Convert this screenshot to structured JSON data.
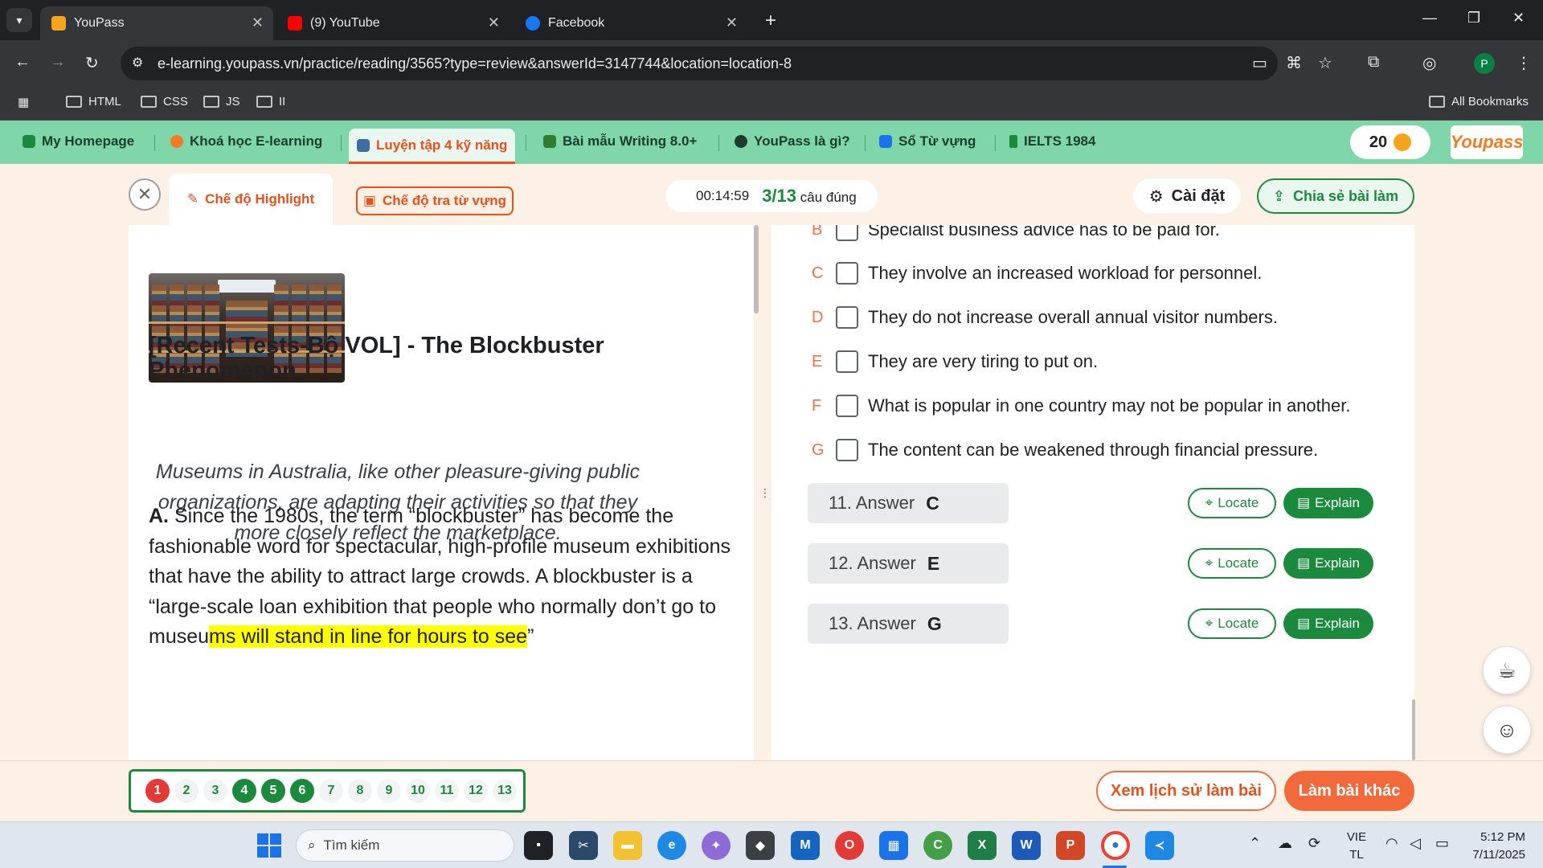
{
  "browser": {
    "tabs": [
      {
        "title": "YouPass",
        "active": true
      },
      {
        "title": "(9) YouTube",
        "active": false
      },
      {
        "title": "Facebook",
        "active": false
      }
    ],
    "url": "e-learning.youpass.vn/practice/reading/3565?type=review&answerId=3147744&location=location-8",
    "bookmarks": [
      "HTML",
      "CSS",
      "JS",
      "II"
    ],
    "all_bookmarks_label": "All Bookmarks",
    "profile_initial": "P"
  },
  "site_nav": {
    "items": [
      "My Homepage",
      "Khoá học E-learning",
      "Luyện tập 4 kỹ năng",
      "Bài mẫu Writing 8.0+",
      "YouPass là gì?",
      "Sổ Từ vựng",
      "IELTS 1984"
    ],
    "active_index": 2,
    "coins": "20",
    "logo_text": "Youpass"
  },
  "mode_bar": {
    "highlight_mode": "Chế độ Highlight",
    "vocab_mode": "Chế độ tra từ vựng",
    "timer": "00:14:59",
    "score": "3/13",
    "score_suffix": "câu đúng",
    "settings": "Cài đặt",
    "share": "Chia sẻ bài làm"
  },
  "article": {
    "title": "[Recent Tests-Bộ VOL] - The Blockbuster Phenomenon",
    "lead": "Museums in Australia, like other pleasure-giving public organizations, are adapting their activities so that they more closely reflect the marketplace.",
    "para_label": "A.",
    "para_text": " Since the 1980s, the term “blockbuster” has become the fashionable word for spectacular, high-profile museum exhibitions that have the ability to attract large crowds. A blockbuster is a “large-scale loan exhibition that people who normally don’t go to museu",
    "para_highlight": "ms will stand in line for hours to see",
    "para_end": "”"
  },
  "options": [
    {
      "letter": "B",
      "text": "Specialist business advice has to be paid for."
    },
    {
      "letter": "C",
      "text": "They involve an increased workload for personnel."
    },
    {
      "letter": "D",
      "text": "They do not increase overall annual visitor numbers."
    },
    {
      "letter": "E",
      "text": "They are very tiring to put on."
    },
    {
      "letter": "F",
      "text": "What is popular in one country may not be popular in another."
    },
    {
      "letter": "G",
      "text": "The content can be weakened through financial pressure."
    }
  ],
  "answers": [
    {
      "label": "11. Answer",
      "value": "C"
    },
    {
      "label": "12. Answer",
      "value": "E"
    },
    {
      "label": "13. Answer",
      "value": "G"
    }
  ],
  "locate_label": "Locate",
  "explain_label": "Explain",
  "question_nav": [
    {
      "n": "1",
      "state": "wrong"
    },
    {
      "n": "2",
      "state": "none"
    },
    {
      "n": "3",
      "state": "none"
    },
    {
      "n": "4",
      "state": "right"
    },
    {
      "n": "5",
      "state": "right"
    },
    {
      "n": "6",
      "state": "right"
    },
    {
      "n": "7",
      "state": "none"
    },
    {
      "n": "8",
      "state": "none"
    },
    {
      "n": "9",
      "state": "none"
    },
    {
      "n": "10",
      "state": "none"
    },
    {
      "n": "11",
      "state": "none"
    },
    {
      "n": "12",
      "state": "none"
    },
    {
      "n": "13",
      "state": "none"
    }
  ],
  "bottom": {
    "history": "Xem lịch sử làm bài",
    "other": "Làm bài khác"
  },
  "taskbar": {
    "search": "Tìm kiếm",
    "lang_top": "VIE",
    "lang_bottom": "TL",
    "time": "5:12 PM",
    "date": "7/11/2025"
  },
  "colors": {
    "accent_green": "#1a8a3c",
    "accent_orange": "#e8501c",
    "nav_green": "#7fd6a8",
    "highlight_yellow": "#ffff00"
  }
}
